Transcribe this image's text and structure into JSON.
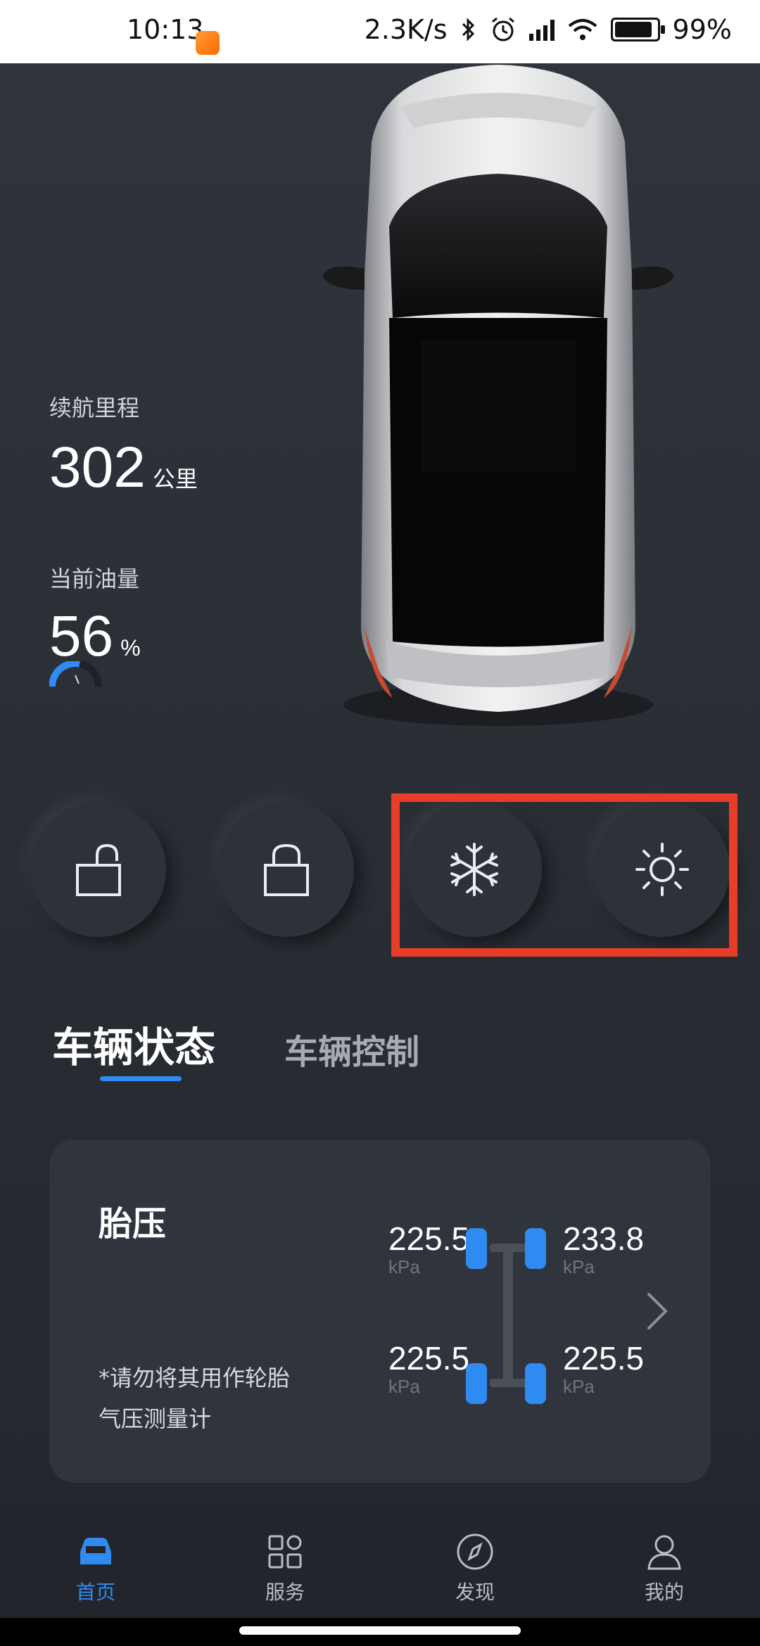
{
  "status_bar": {
    "time": "10:13",
    "network_speed": "2.3K/s",
    "battery": "99%"
  },
  "stats": {
    "range_label": "续航里程",
    "range_value": "302",
    "range_unit": "公里",
    "fuel_label": "当前油量",
    "fuel_value": "56",
    "fuel_unit": "%",
    "fuel_level_fraction": 0.56
  },
  "quick_actions": [
    {
      "name": "unlock",
      "icon": "unlock-icon"
    },
    {
      "name": "lock",
      "icon": "lock-icon"
    },
    {
      "name": "cool",
      "icon": "snowflake-icon"
    },
    {
      "name": "heat",
      "icon": "sun-icon"
    }
  ],
  "tabs": {
    "active": "车辆状态",
    "inactive": "车辆控制"
  },
  "tire_card": {
    "title": "胎压",
    "note": "*请勿将其用作轮胎气压测量计",
    "front_left": {
      "value": "225.5",
      "unit": "kPa"
    },
    "front_right": {
      "value": "233.8",
      "unit": "kPa"
    },
    "rear_left": {
      "value": "225.5",
      "unit": "kPa"
    },
    "rear_right": {
      "value": "225.5",
      "unit": "kPa"
    }
  },
  "nav": {
    "home": "首页",
    "service": "服务",
    "discover": "发现",
    "mine": "我的"
  },
  "colors": {
    "accent": "#2f8bf1",
    "highlight": "#e83d28",
    "background": "#2b2f36"
  }
}
